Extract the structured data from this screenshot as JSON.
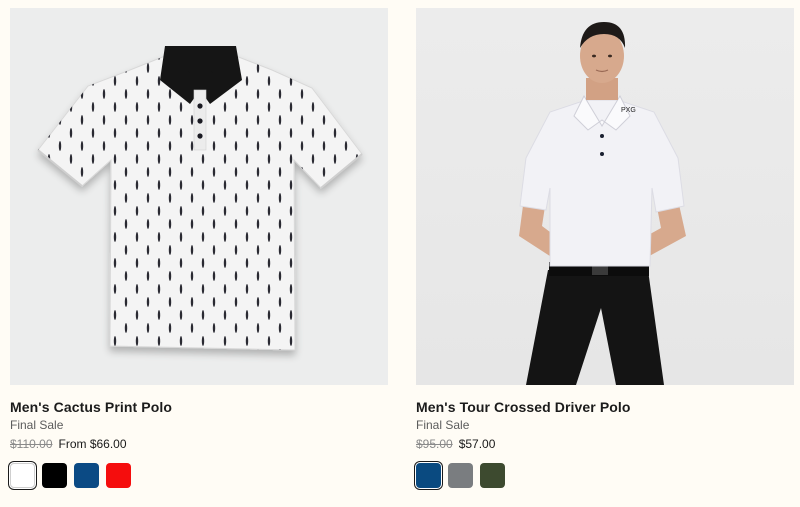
{
  "products": [
    {
      "title": "Men's Cactus Print Polo",
      "sale_label": "Final Sale",
      "original_price": "$110.00",
      "sale_price": "From $66.00",
      "image_icon": "polo-shirt-flatlay-image",
      "swatches": [
        {
          "name": "white",
          "color": "#ffffff",
          "selected": true
        },
        {
          "name": "black",
          "color": "#000000",
          "selected": false
        },
        {
          "name": "navy",
          "color": "#0b4a84",
          "selected": false
        },
        {
          "name": "red",
          "color": "#f50d0d",
          "selected": false
        }
      ]
    },
    {
      "title": "Men's Tour Crossed Driver Polo",
      "sale_label": "Final Sale",
      "original_price": "$95.00",
      "sale_price": "$57.00",
      "image_icon": "model-wearing-polo-image",
      "swatches": [
        {
          "name": "navy",
          "color": "#0a4a80",
          "selected": true
        },
        {
          "name": "gray",
          "color": "#7a7d80",
          "selected": false
        },
        {
          "name": "olive",
          "color": "#3d4a2f",
          "selected": false
        }
      ]
    }
  ]
}
